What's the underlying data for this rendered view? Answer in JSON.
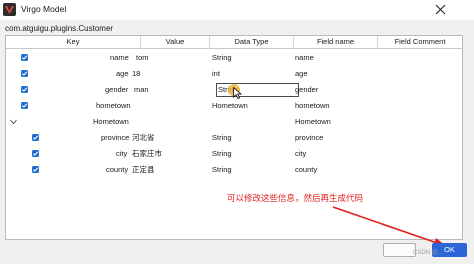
{
  "window": {
    "title": "Virgo Model",
    "close_icon": "close-icon",
    "app_icon": "virgo-logo-icon"
  },
  "class_path": "com.atguigu.plugins.Customer",
  "columns": [
    "Key",
    "Value",
    "Data Type",
    "Field name",
    "Field Comment"
  ],
  "rows": [
    {
      "key": "name",
      "value": "tom",
      "data_type": "String",
      "field_name": "name",
      "comment": "",
      "checked": true
    },
    {
      "key": "age",
      "value": "18",
      "data_type": "int",
      "field_name": "age",
      "comment": "",
      "checked": true
    },
    {
      "key": "gender",
      "value": "man",
      "data_type": "String",
      "field_name": "gender",
      "comment": "",
      "checked": true
    },
    {
      "key": "hometown",
      "value": "",
      "data_type": "Hometown",
      "field_name": "hometown",
      "comment": "",
      "checked": true
    },
    {
      "key": "Hometown",
      "value": "",
      "data_type": "",
      "field_name": "Hometown",
      "comment": "",
      "expander": true
    },
    {
      "key": "province",
      "value": "河北省",
      "data_type": "String",
      "field_name": "province",
      "comment": "",
      "checked": true
    },
    {
      "key": "city",
      "value": "石家庄市",
      "data_type": "String",
      "field_name": "city",
      "comment": "",
      "checked": true
    },
    {
      "key": "county",
      "value": "正定县",
      "data_type": "String",
      "field_name": "county",
      "comment": "",
      "checked": true
    }
  ],
  "annotation": "可以修改这些信息，然后再生成代码",
  "buttons": {
    "cancel": "",
    "ok": "OK"
  },
  "watermark": "CSDN @...",
  "colors": {
    "accent": "#2b66d8",
    "checkbox": "#1f6fd1",
    "annotation": "#e0201b",
    "highlight": "#f0b23a"
  }
}
